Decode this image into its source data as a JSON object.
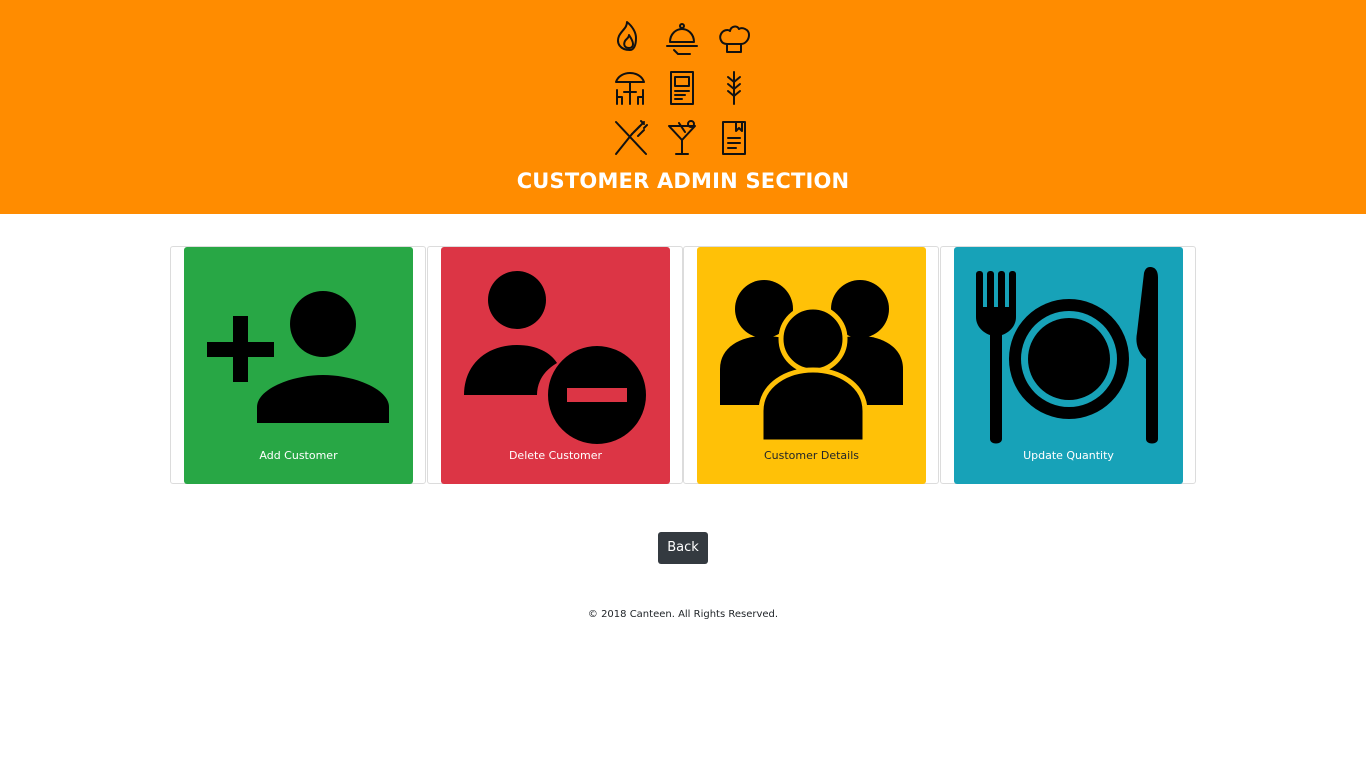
{
  "header": {
    "title": "CUSTOMER ADMIN SECTION",
    "background": "#ff8c00",
    "logo_icons": [
      "flame-icon",
      "cloche-icon",
      "chef-hat-icon",
      "table-umbrella-icon",
      "menu-card-icon",
      "wheat-icon",
      "crossed-fork-knife-icon",
      "cocktail-icon",
      "recipe-book-icon"
    ]
  },
  "cards": [
    {
      "label": "Add Customer",
      "icon": "add-user-icon",
      "color": "#28a745"
    },
    {
      "label": "Delete Customer",
      "icon": "remove-user-icon",
      "color": "#dc3545"
    },
    {
      "label": "Customer Details",
      "icon": "user-group-icon",
      "color": "#ffc107"
    },
    {
      "label": "Update Quantity",
      "icon": "plate-fork-knife-icon",
      "color": "#17a2b8"
    }
  ],
  "back_button": {
    "label": "Back"
  },
  "footer": {
    "text": "© 2018 Canteen. All Rights Reserved."
  }
}
